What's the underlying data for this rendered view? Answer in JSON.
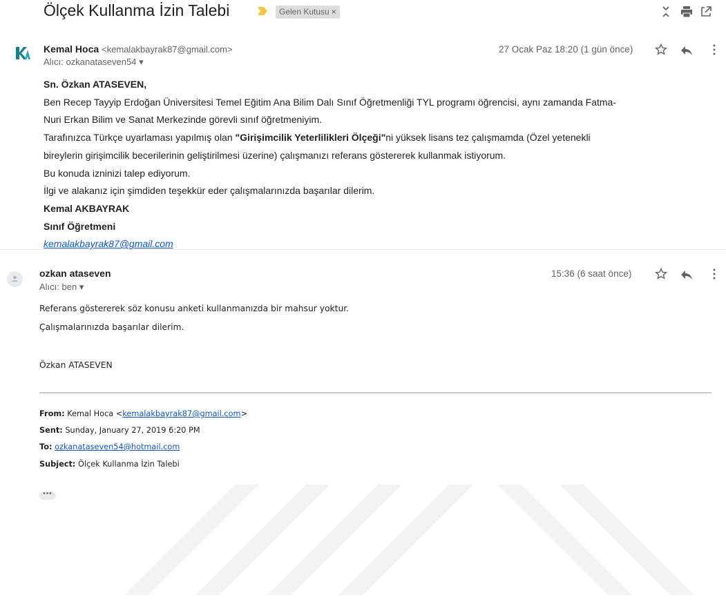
{
  "thread": {
    "subject": "Ölçek Kullanma İzin Talebi",
    "label": "Gelen Kutusu",
    "label_close": "×",
    "icons": [
      "expand-collapse-icon",
      "print-icon",
      "open-new-window-icon"
    ]
  },
  "message1": {
    "sender_name": "Kemal Hoca",
    "sender_email": "<kemalakbayrak87@gmail.com>",
    "recipient_prefix": "Alıcı:",
    "recipient": "ozkanataseven54",
    "date": "27 Ocak Paz 18:20 (1 gün önce)",
    "body": {
      "greeting": "Sn. Özkan ATASEVEN,",
      "line1": "Ben Recep Tayyip Erdoğan Üniversitesi Temel Eğitim Ana Bilim Dalı Sınıf Öğretmenliği TYL programı öğrencisi, aynı zamanda Fatma-",
      "line2": "Nuri Erkan Bilim ve Sanat Merkezinde görevli sınıf öğretmeniyim.",
      "line3_pre": "Tarafınızca Türkçe uyarlaması yapılmış olan ",
      "line3_bold": "\"Girişimcilik Yeterlilikleri Ölçeği\"",
      "line3_post": "ni yüksek lisans tez çalışmamda (Özel yetenekli",
      "line4": "bireylerin girişimcilik becerilerinin geliştirilmesi üzerine) çalışmanızı referans göstererek kullanmak istiyorum.",
      "line5": "Bu konuda izninizi talep ediyorum.",
      "line6": "İlgi ve alakanız için şimdiden teşekkür eder çalışmalarınızda başarılar dilerim.",
      "sign_name": "Kemal AKBAYRAK",
      "sign_title": "Sınıf Öğretmeni",
      "sign_email": "kemalakbayrak87@gmail.com"
    }
  },
  "message2": {
    "sender_name": "ozkan ataseven",
    "recipient_prefix": "Alıcı:",
    "recipient": "ben",
    "date": "15:36 (6 saat önce)",
    "body": {
      "line1": "Referans göstererek söz konusu anketi kullanmanızda bir mahsur yoktur.",
      "line2": "Çalışmalarınızda başarılar dilerim.",
      "signature": "Özkan ATASEVEN"
    },
    "quoted": {
      "from_label": "From:",
      "from_name": "Kemal Hoca <",
      "from_email": "kemalakbayrak87@gmail.com",
      "from_close": ">",
      "sent_label": "Sent:",
      "sent_value": "Sunday, January 27, 2019 6:20 PM",
      "to_label": "To:",
      "to_value": "ozkanataseven54@hotmail.com",
      "subject_label": "Subject:",
      "subject_value": "Ölçek Kullanma İzin Talebi"
    },
    "show_trimmed": "•••"
  },
  "colors": {
    "link": "#1155cc",
    "importance_marker": "#f4c542",
    "chip_bg": "#dddddd",
    "avatar_accent": "#1a7f8a",
    "watermark": "#f2f2f2"
  }
}
